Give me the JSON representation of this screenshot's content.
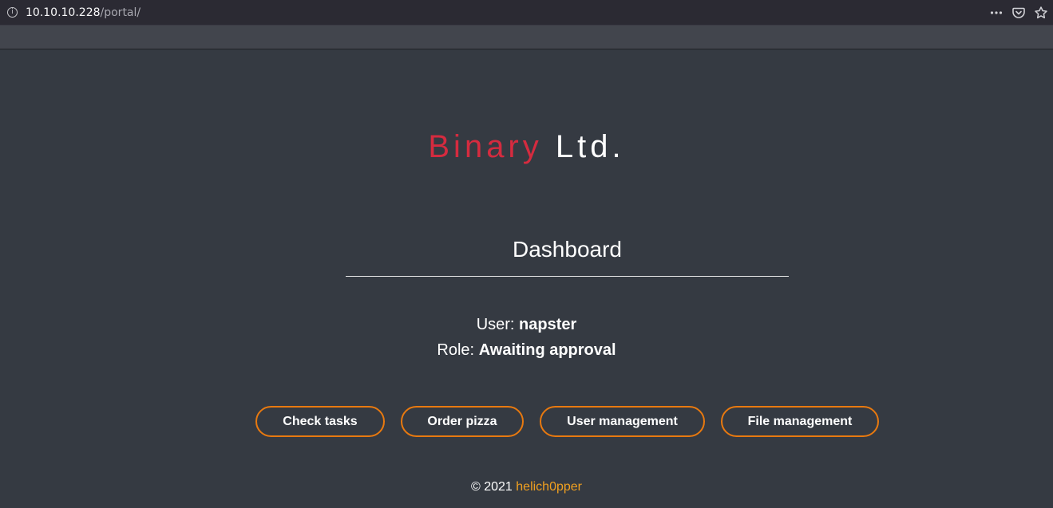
{
  "browser": {
    "url_host": "10.10.10.228",
    "url_path": "/portal/",
    "info_icon": "info-icon",
    "menu_icon": "more-options-icon",
    "pocket_icon": "pocket-icon",
    "bookmark_icon": "bookmark-star-icon"
  },
  "brand": {
    "part1": "Binary",
    "part2": "Ltd.",
    "part1_color": "#d52b3f"
  },
  "dashboard": {
    "title": "Dashboard",
    "user_label": "User:",
    "user_value": "napster",
    "role_label": "Role:",
    "role_value": "Awaiting approval"
  },
  "buttons": {
    "check_tasks": "Check tasks",
    "order_pizza": "Order pizza",
    "user_management": "User management",
    "file_management": "File management",
    "border_color": "#e8790f"
  },
  "footer": {
    "copyright": "© 2021",
    "author": "helich0pper",
    "author_color": "#f0a020"
  },
  "colors": {
    "background": "#353a42",
    "text": "#ffffff"
  }
}
